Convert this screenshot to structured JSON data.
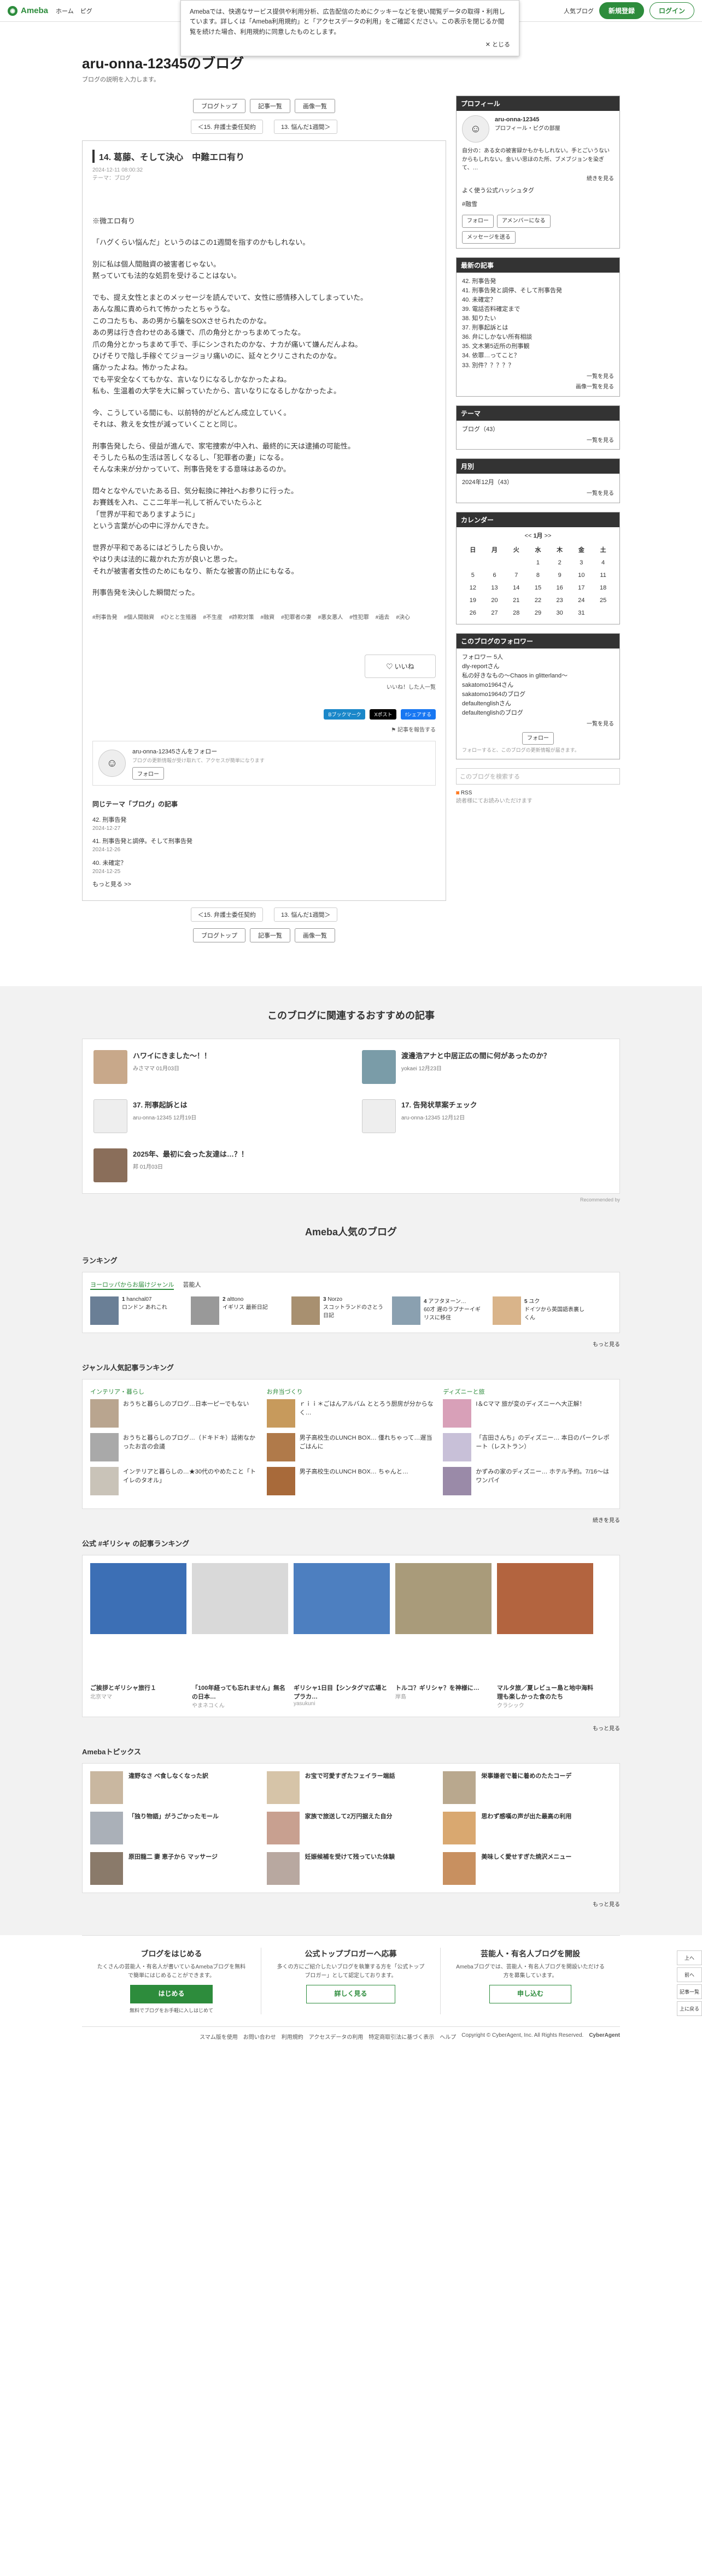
{
  "header": {
    "logo": "Ameba",
    "logo_sub": "20th Anniv",
    "nav": [
      "ホーム",
      "ピグ"
    ],
    "popular_blog": "人気ブログ",
    "register": "新規登録",
    "login": "ログイン"
  },
  "cookie": {
    "text": "Amebaでは、快適なサービス提供や利用分析、広告配信のためにクッキーなどを使い閲覧データの取得・利用しています。詳しくは「Ameba利用規約」と「アクセスデータの利用」をご確認ください。この表示を閉じるか閲覧を続けた場合、利用規約に同意したものとします。",
    "close": "とじる"
  },
  "blog": {
    "title": "aru-onna-12345のブログ",
    "description": "ブログの説明を入力します。"
  },
  "buttons": {
    "top": "ブログトップ",
    "list": "記事一覧",
    "images": "画像一覧"
  },
  "pager": {
    "prev": "＜15. 弁護士委任契約",
    "next": "13. 悩んだ1週間＞"
  },
  "entry": {
    "title": "14. 葛藤、そして決心　中難エロ有り",
    "date": "2024-12-11 08:00:32",
    "theme": "テーマ：ブログ",
    "paragraphs": [
      "※微エロ有り",
      "「ハグくらい悩んだ」というのはこの1週間を指すのかもしれない。",
      "別に私は個人間融資の被害者じゃない。\n黙っていても法的な処罰を受けることはない。",
      "でも、提え女性とまとのメッセージを読んでいて、女性に感情移入してしまっていた。\nあんな風に責められて怖かったとちゃうな。\nこのコたちも、あの男から騙をSOXさせられたのかな。\nあの男は行き合わせのある嫌で、爪の角分とかっちまめてったな。\n爪の角分とかっちまめて手で、手にシンされたのかな、ナカが痛いて嫌んだんよね。\nひげそりで陰し手稼ぐてジョージョリ痛いのに、延々とクリこされたのかな。\n痛かったよね。怖かったよね。\nでも平安全なくてもかな、言いなりになるしかなかったよね。\n私も、生温着の大学を大に解っていたから、言いなりになるしかなかったよ。",
      "今、こうしている間にも、以前特的がどんどん成立していく。\nそれは、救えを女性が減っていくことと同じ。",
      "刑事告発したら、侵益が進んで、家宅捜索が中入れ、最終的に天は逮捕の可能性。\nそうしたら私の生活は苦しくなるし、「犯罪者の妻」になる。\nそんな未来が分かっていて、刑事告発をする意味はあるのか。",
      "悶々となやんでいたある日、気分転換に神社へお参りに行った。\nお賽銭を入れ、ここ二年半一礼して祈んでいたらふと\n「世界が平和でありますように」\nという言葉が心の中に浮かんできた。",
      "世界が平和であるにはどうしたら良いか。\nやはり夫は法的に裁かれた方が良いと思った。\nそれが被害者女性のためにもなり、新たな被害の防止にもなる。",
      "刑事告発を決心した瞬間だった。"
    ],
    "tags": [
      "#刑事告発",
      "#個人間融資",
      "#ひとと生殖器",
      "#不生産",
      "#詐欺対策",
      "#融資",
      "#犯罪者の妻",
      "#悪女悪人",
      "#性犯罪",
      "#過去",
      "#決心"
    ],
    "like": "いいね",
    "like_caption": "いいね！した人一覧",
    "share": [
      "Bブックマーク",
      "Xポスト",
      "fシェアする"
    ],
    "report": "記事を報告する",
    "follow_name": "aru-onna-12345さんをフォロー",
    "follow_sub": "ブログの更新情報が受け取れて、アクセスが簡単になります",
    "follow_btn": "フォロー"
  },
  "related": {
    "title": "同じテーマ「ブログ」の記事",
    "items": [
      {
        "t": "42. 刑事告発",
        "d": "2024-12-27"
      },
      {
        "t": "41. 刑事告発と調停。そして刑事告発",
        "d": "2024-12-26"
      },
      {
        "t": "40. 未確定？",
        "d": "2024-12-25"
      }
    ],
    "more": "もっと見る >>"
  },
  "sidebar": {
    "profile": {
      "title": "プロフィール",
      "name": "aru-onna-12345",
      "links": "プロフィール・ピグの部屋",
      "bio": "自分の：ある女の被害録かもかもしれない。手とごいうないからもしれない。金いい思ほのた所、ブメブジョンを染ぎて、…",
      "more": "続きを見る",
      "fav": "よく使う公式ハッシュタグ",
      "tag": "#融雪",
      "btn_follow": "フォロー",
      "btn_app": "アメンバーになる",
      "btn_msg": "メッセージを送る"
    },
    "recent": {
      "title": "最新の記事",
      "items": [
        "42. 刑事告発",
        "41. 刑事告発と調停、そして刑事告発",
        "40. 未確定？",
        "39. 電話否料確定まで",
        "38. 知りたい",
        "37. 刑事起訴とは",
        "36. 弁にしかない所有相談",
        "35. 文木第5近所の刑事観",
        "34. 依罪…ってこと？",
        "33. 別件？？？？？"
      ],
      "more": "一覧を見る",
      "more2": "画像一覧を見る"
    },
    "theme": {
      "title": "テーマ",
      "items": [
        "ブログ（43）"
      ],
      "more": "一覧を見る"
    },
    "archive": {
      "title": "月別",
      "items": [
        "2024年12月（43）"
      ],
      "more": "一覧を見る"
    },
    "calendar": {
      "title": "カレンダー",
      "month": "1月",
      "prev": "<<",
      "next": ">>",
      "days": [
        "日",
        "月",
        "火",
        "水",
        "木",
        "金",
        "土"
      ],
      "weeks": [
        [
          "",
          "",
          "",
          "1",
          "2",
          "3",
          "4"
        ],
        [
          "5",
          "6",
          "7",
          "8",
          "9",
          "10",
          "11"
        ],
        [
          "12",
          "13",
          "14",
          "15",
          "16",
          "17",
          "18"
        ],
        [
          "19",
          "20",
          "21",
          "22",
          "23",
          "24",
          "25"
        ],
        [
          "26",
          "27",
          "28",
          "29",
          "30",
          "31",
          ""
        ]
      ]
    },
    "followers": {
      "title": "このブログのフォロワー",
      "count": "フォロワー 5人",
      "items": [
        "dly-reportさん",
        "私の好きなもの〜Chaos in glitterland〜",
        "sakatomo1964さん",
        "sakatomo1964のブログ",
        "defaultenglishさん",
        "defaultenglishのブログ"
      ],
      "more": "一覧を見る",
      "btn": "フォロー",
      "note": "フォローすると、このブログの更新情報が届きます。"
    },
    "search_placeholder": "このブログを検索する",
    "rss": "RSS",
    "rss_sub": "読者様にてお読みいただけます"
  },
  "recommend": {
    "title": "このブログに関連するおすすめの記事",
    "items": [
      {
        "t": "ハワイにきました〜！！",
        "u": "みさママ",
        "d": "01月03日"
      },
      {
        "t": "渡邊浩アナと中居正広の間に何があったのか？",
        "u": "yokaei",
        "d": "12月23日"
      },
      {
        "t": "37. 刑事起訴とは",
        "u": "aru-onna-12345",
        "d": "12月19日"
      },
      {
        "t": "17. 告発状草案チェック",
        "u": "aru-onna-12345",
        "d": "12月12日"
      },
      {
        "t": "2025年、最初に会った友達は…？！",
        "u": "邦",
        "d": "01月03日"
      }
    ],
    "credit": "Recommended by"
  },
  "popular": {
    "title": "Ameba人気のブログ",
    "ranking": "ランキング",
    "tabs": [
      "ヨーロッパからお届けジャンル",
      "芸能人"
    ],
    "rank_items": [
      {
        "n": "1",
        "name": "hanchal07",
        "desc": "ロンドン あれこれ"
      },
      {
        "n": "2",
        "name": "alttono",
        "desc": "イギリス 最新日記"
      },
      {
        "n": "3",
        "name": "Norzo",
        "desc": "スコットランドのさとう日記"
      },
      {
        "n": "4",
        "name": "アフタヌーン…",
        "desc": "60才 遅のラプナーイギリスに移住"
      },
      {
        "n": "5",
        "name": "ユク",
        "desc": "ドイツから英国語表裏しくん"
      }
    ],
    "more": "もっと見る",
    "genre_title": "ジャンル人気記事ランキング",
    "genres": [
      {
        "name": "インテリア・暮らし",
        "items": [
          "おうちと暮らしのブログ…日本一ピーでもない"
        ],
        "items2": [
          "おうちと暮らしのブログ…（ドキドキ）話術なかったお言の会議",
          "インテリアと暮らしの…★30代のやめたこと「トイレのタオル」"
        ]
      },
      {
        "name": "お弁当づくり",
        "items": [
          "ｒｉｉ＊ごはんアルバム ととろう厨房が分からなく…"
        ],
        "items2": [
          "男子高校生のLUNCH BOX… 僅れちゃって…遅当ごはんに",
          "男子高校生のLUNCH BOX… ちゃんと…"
        ]
      },
      {
        "name": "ディズニーと旅",
        "items": [
          "I＆Cママ 旅が変のディズニーへ大正解！"
        ],
        "items2": [
          "「吉田さんち」のディズニー… 本日のパークレポート（レストラン）",
          "かずみの家のディズニー… ホテル予約。7/16〜はワンパイ"
        ]
      }
    ],
    "more2": "続きを見る",
    "hashtag_title": "公式 #ギリシャ の記事ランキング",
    "hashtag_items": [
      {
        "n": "1",
        "t": "ご挨拶とギリシャ旅行１",
        "u": "北京ママ"
      },
      {
        "n": "2",
        "t": "「100年経っても忘れません」無名の日本…",
        "u": "やまネコくん"
      },
      {
        "n": "3",
        "t": "ギリシャ1日目【シンタグマ広場とプラカ…",
        "u": "yasukuni"
      },
      {
        "n": "4",
        "t": "トルコ？ギリシャ？を神様に…",
        "u": "岸島"
      },
      {
        "n": "5",
        "t": "マルタ旅／夏レビュー島と地中海料理も楽しかった食のたち",
        "u": "クラシック"
      }
    ],
    "more3": "もっと見る",
    "topics_title": "Amebaトピックス",
    "topics": [
      "違野なさ ベ食しなくなった訳",
      "お宝で可愛すぎたフェイラー端話",
      "栄事嫌者で着に着めのたたコーデ",
      "「独り物語」がうごかったモール",
      "家族で旅送して2万円据えた自分",
      "思わず感嘆の声が出た最高の利用",
      "原田龍二 妻 恵子から マッサージ",
      "妊娠候補を受けて残っていた体験",
      "美味しく愛せすぎた焼沢メニュー"
    ],
    "more4": "もっと見る"
  },
  "footer": {
    "cols": [
      {
        "t": "ブログをはじめる",
        "d": "たくさんの芸能人・有名人が書いているAmebaブログを無料で簡単にはじめることができます。",
        "b": "はじめる",
        "s": "無料でブログをお手軽に入しはじめて"
      },
      {
        "t": "公式トップブロガーへ応募",
        "d": "多くの方にご紹介したいブログを執筆する方を「公式トップブロガー」として認定しております。",
        "b": "詳しく見る",
        "s": ""
      },
      {
        "t": "芸能人・有名人ブログを開設",
        "d": "Amebaブログでは、芸能人・有名人ブログを開設いただける方を募集しています。",
        "b": "申し込む",
        "s": ""
      }
    ],
    "links": [
      "スマム版を使用",
      "お問い合わせ",
      "利用規約",
      "アクセスデータの利用",
      "特定商取引法に基づく表示",
      "ヘルプ"
    ],
    "copy": "Copyright © CyberAgent, Inc. All Rights Reserved.",
    "brand": "CyberAgent"
  },
  "pagetop": [
    "上へ",
    "前へ",
    "記事一覧",
    "上に戻る"
  ]
}
